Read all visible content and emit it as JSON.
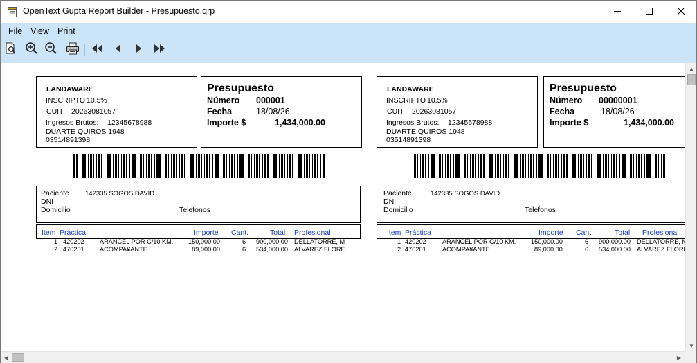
{
  "window": {
    "title": "OpenText Gupta Report Builder - Presupuesto.qrp",
    "icon": "report-document-icon",
    "controls": [
      "minimize-icon",
      "maximize-icon",
      "close-icon"
    ]
  },
  "menu": [
    "File",
    "View",
    "Print"
  ],
  "toolbar": {
    "buttons": [
      "print-preview-icon",
      "zoom-in-icon",
      "zoom-out-icon",
      "printer-icon",
      "first-page-icon",
      "previous-page-icon",
      "next-page-icon",
      "last-page-icon"
    ]
  },
  "pages": [
    {
      "company": {
        "name": "LANDAWARE",
        "inscripto_label": "INSCRIPTO",
        "inscripto_value": "10.5%",
        "cuit_label": "CUIT",
        "cuit_value": "20263081057",
        "ib_label": "Ingresos Brutos:",
        "ib_value": "12345678988",
        "address": "DUARTE QUIROS 1948",
        "phone": "03514891398"
      },
      "document": {
        "title": "Presupuesto",
        "numero_label": "Número",
        "numero_value": "000001",
        "fecha_label": "Fecha",
        "fecha_value": "18/08/26",
        "importe_label": "Importe $",
        "importe_value": "1,434,000.00"
      },
      "patient": {
        "paciente_label": "Paciente",
        "paciente_value": "142335 SOGOS DAVID",
        "dni_label": "DNI",
        "domicilio_label": "Domicilio",
        "telefonos_label": "Telefonos"
      },
      "table": {
        "headers": [
          "Item",
          "Práctica",
          "Importe",
          "Cant.",
          "Total",
          "Profesional"
        ],
        "rows": [
          [
            "1",
            "420202",
            "ARANCEL POR C/10 KM.",
            "150,000.00",
            "6",
            "900,000.00",
            "DELLATORRE, M"
          ],
          [
            "2",
            "470201",
            "ACOMPA¥ANTE",
            "89,000.00",
            "6",
            "534,000.00",
            "ALVAREZ FLORE"
          ]
        ]
      }
    },
    {
      "company": {
        "name": "LANDAWARE",
        "inscripto_label": "INSCRIPTO",
        "inscripto_value": "10.5%",
        "cuit_label": "CUIT",
        "cuit_value": "20263081057",
        "ib_label": "Ingresos Brutos:",
        "ib_value": "12345678988",
        "address": "DUARTE QUIROS 1948",
        "phone": "03514891398"
      },
      "document": {
        "title": "Presupuesto",
        "numero_label": "Número",
        "numero_value": "00000001",
        "fecha_label": "Fecha",
        "fecha_value": "18/08/26",
        "importe_label": "Importe $",
        "importe_value": "1,434,000.00"
      },
      "patient": {
        "paciente_label": "Paciente",
        "paciente_value": "142335 SOGOS DAVID",
        "dni_label": "DNI",
        "domicilio_label": "Domicilio",
        "telefonos_label": "Telefonos"
      },
      "table": {
        "headers": [
          "Item",
          "Práctica",
          "Importe",
          "Cant.",
          "Total",
          "Profesional"
        ],
        "rows": [
          [
            "1",
            "420202",
            "ARANCEL POR C/10 KM.",
            "150,000.00",
            "6",
            "900,000.00",
            "DELLATORRE, M"
          ],
          [
            "2",
            "470201",
            "ACOMPA¥ANTE",
            "89,000.00",
            "6",
            "534,000.00",
            "ALVAREZ FLORE"
          ]
        ]
      }
    }
  ],
  "colors": {
    "band": "#cce4f7",
    "header_text": "#1a3bd6"
  }
}
